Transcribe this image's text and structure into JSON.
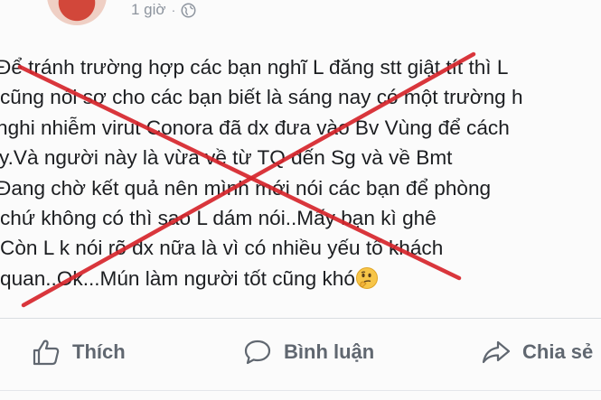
{
  "post": {
    "timestamp": "1 giờ",
    "separator": "·",
    "privacy_icon": "globe-icon",
    "lines": [
      "Để tránh trường hợp các bạn nghĩ L đăng stt giật tít thì L",
      "cũng nói sơ cho các bạn biết là sáng nay có một trường h",
      "nghi nhiễm virut Conora đã dx đưa vào Bv Vùng để cách",
      "ly.Và người này là vừa về từ TQ đến Sg và về Bmt",
      "Đang chờ kết quả nên mình mới nói các bạn để phòng",
      "chứ không có thì sao L dám nói..Mấy bạn kì ghê",
      "Còn L k nói rõ dx nữa là vì có nhiều yếu tố khách",
      "quan..Ok...Mún làm người tốt cũng khó"
    ],
    "end_emoji": "thinking-face-emoji",
    "overlay": "red-cross-mark"
  },
  "actions": {
    "like_label": "Thích",
    "comment_label": "Bình luận",
    "share_label": "Chia sẻ"
  },
  "colors": {
    "text": "#1c1e21",
    "muted": "#606770",
    "cross": "#d7262c"
  }
}
